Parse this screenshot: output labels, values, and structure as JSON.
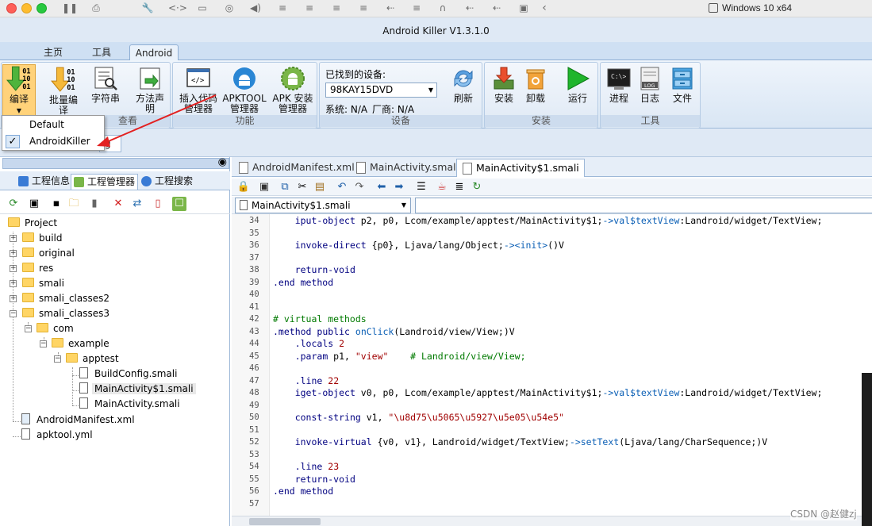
{
  "mac": {
    "window_label": "Windows 10 x64"
  },
  "app": {
    "title": "Android Killer V1.3.1.0"
  },
  "ribbon_tabs": [
    "主页",
    "工具",
    "Android"
  ],
  "ribbon": {
    "compile": {
      "label1": "编",
      "label2": "译"
    },
    "batch": {
      "label1": "批量编",
      "label2": "译"
    },
    "string": {
      "label": "字符串"
    },
    "method": {
      "label1": "方法声",
      "label2": "明"
    },
    "group_view": "查看",
    "insert": {
      "label1": "插入代码",
      "label2": "管理器"
    },
    "apktool": {
      "label1": "APKTOOL",
      "label2": "管理器"
    },
    "apkinstall": {
      "label1": "APK 安装",
      "label2": "管理器"
    },
    "group_func": "功能",
    "device": {
      "found_label": "已找到的设备:",
      "selected": "98KAY15DVD",
      "system": "系统: N/A",
      "vendor": "厂商: N/A"
    },
    "refresh": "刷新",
    "group_device": "设备",
    "install": "安装",
    "uninstall": "卸载",
    "run": "运行",
    "group_install": "安装",
    "process": "进程",
    "log": "日志",
    "file": "文件",
    "group_tools": "工具"
  },
  "dropdown": {
    "items": [
      "Default",
      "AndroidKiller"
    ],
    "checked": "AndroidKiller",
    "partial_tab": "g"
  },
  "left_tabs": [
    "工程信息",
    "工程管理器",
    "工程搜索"
  ],
  "tree": {
    "root": "Project",
    "items": [
      "build",
      "original",
      "res",
      "smali",
      "smali_classes2",
      "smali_classes3",
      "com",
      "example",
      "apptest",
      "BuildConfig.smali",
      "MainActivity$1.smali",
      "MainActivity.smali",
      "AndroidManifest.xml",
      "apktool.yml"
    ]
  },
  "editor": {
    "tabs": [
      "AndroidManifest.xml",
      "MainActivity.smali",
      "MainActivity$1.smali"
    ],
    "combo": "MainActivity$1.smali",
    "lines": [
      {
        "n": "34",
        "t": "    iput-object p2, p0, Lcom/example/apptest/MainActivity$1;->val$textView:Landroid/widget/TextView;"
      },
      {
        "n": "35",
        "t": ""
      },
      {
        "n": "36",
        "t": "    invoke-direct {p0}, Ljava/lang/Object;-><init>()V"
      },
      {
        "n": "37",
        "t": ""
      },
      {
        "n": "38",
        "t": "    return-void"
      },
      {
        "n": "39",
        "t": ".end method"
      },
      {
        "n": "40",
        "t": ""
      },
      {
        "n": "41",
        "t": ""
      },
      {
        "n": "42",
        "t": "# virtual methods"
      },
      {
        "n": "43",
        "t": ".method public onClick(Landroid/view/View;)V"
      },
      {
        "n": "44",
        "t": "    .locals 2"
      },
      {
        "n": "45",
        "t": "    .param p1, \"view\"    # Landroid/view/View;"
      },
      {
        "n": "46",
        "t": ""
      },
      {
        "n": "47",
        "t": "    .line 22"
      },
      {
        "n": "48",
        "t": "    iget-object v0, p0, Lcom/example/apptest/MainActivity$1;->val$textView:Landroid/widget/TextView;"
      },
      {
        "n": "49",
        "t": ""
      },
      {
        "n": "50",
        "t": "    const-string v1, \"\\u8d75\\u5065\\u5927\\u5e05\\u54e5\""
      },
      {
        "n": "51",
        "t": ""
      },
      {
        "n": "52",
        "t": "    invoke-virtual {v0, v1}, Landroid/widget/TextView;->setText(Ljava/lang/CharSequence;)V"
      },
      {
        "n": "53",
        "t": ""
      },
      {
        "n": "54",
        "t": "    .line 23"
      },
      {
        "n": "55",
        "t": "    return-void"
      },
      {
        "n": "56",
        "t": ".end method"
      },
      {
        "n": "57",
        "t": ""
      }
    ]
  },
  "watermark": "CSDN @赵健zj"
}
